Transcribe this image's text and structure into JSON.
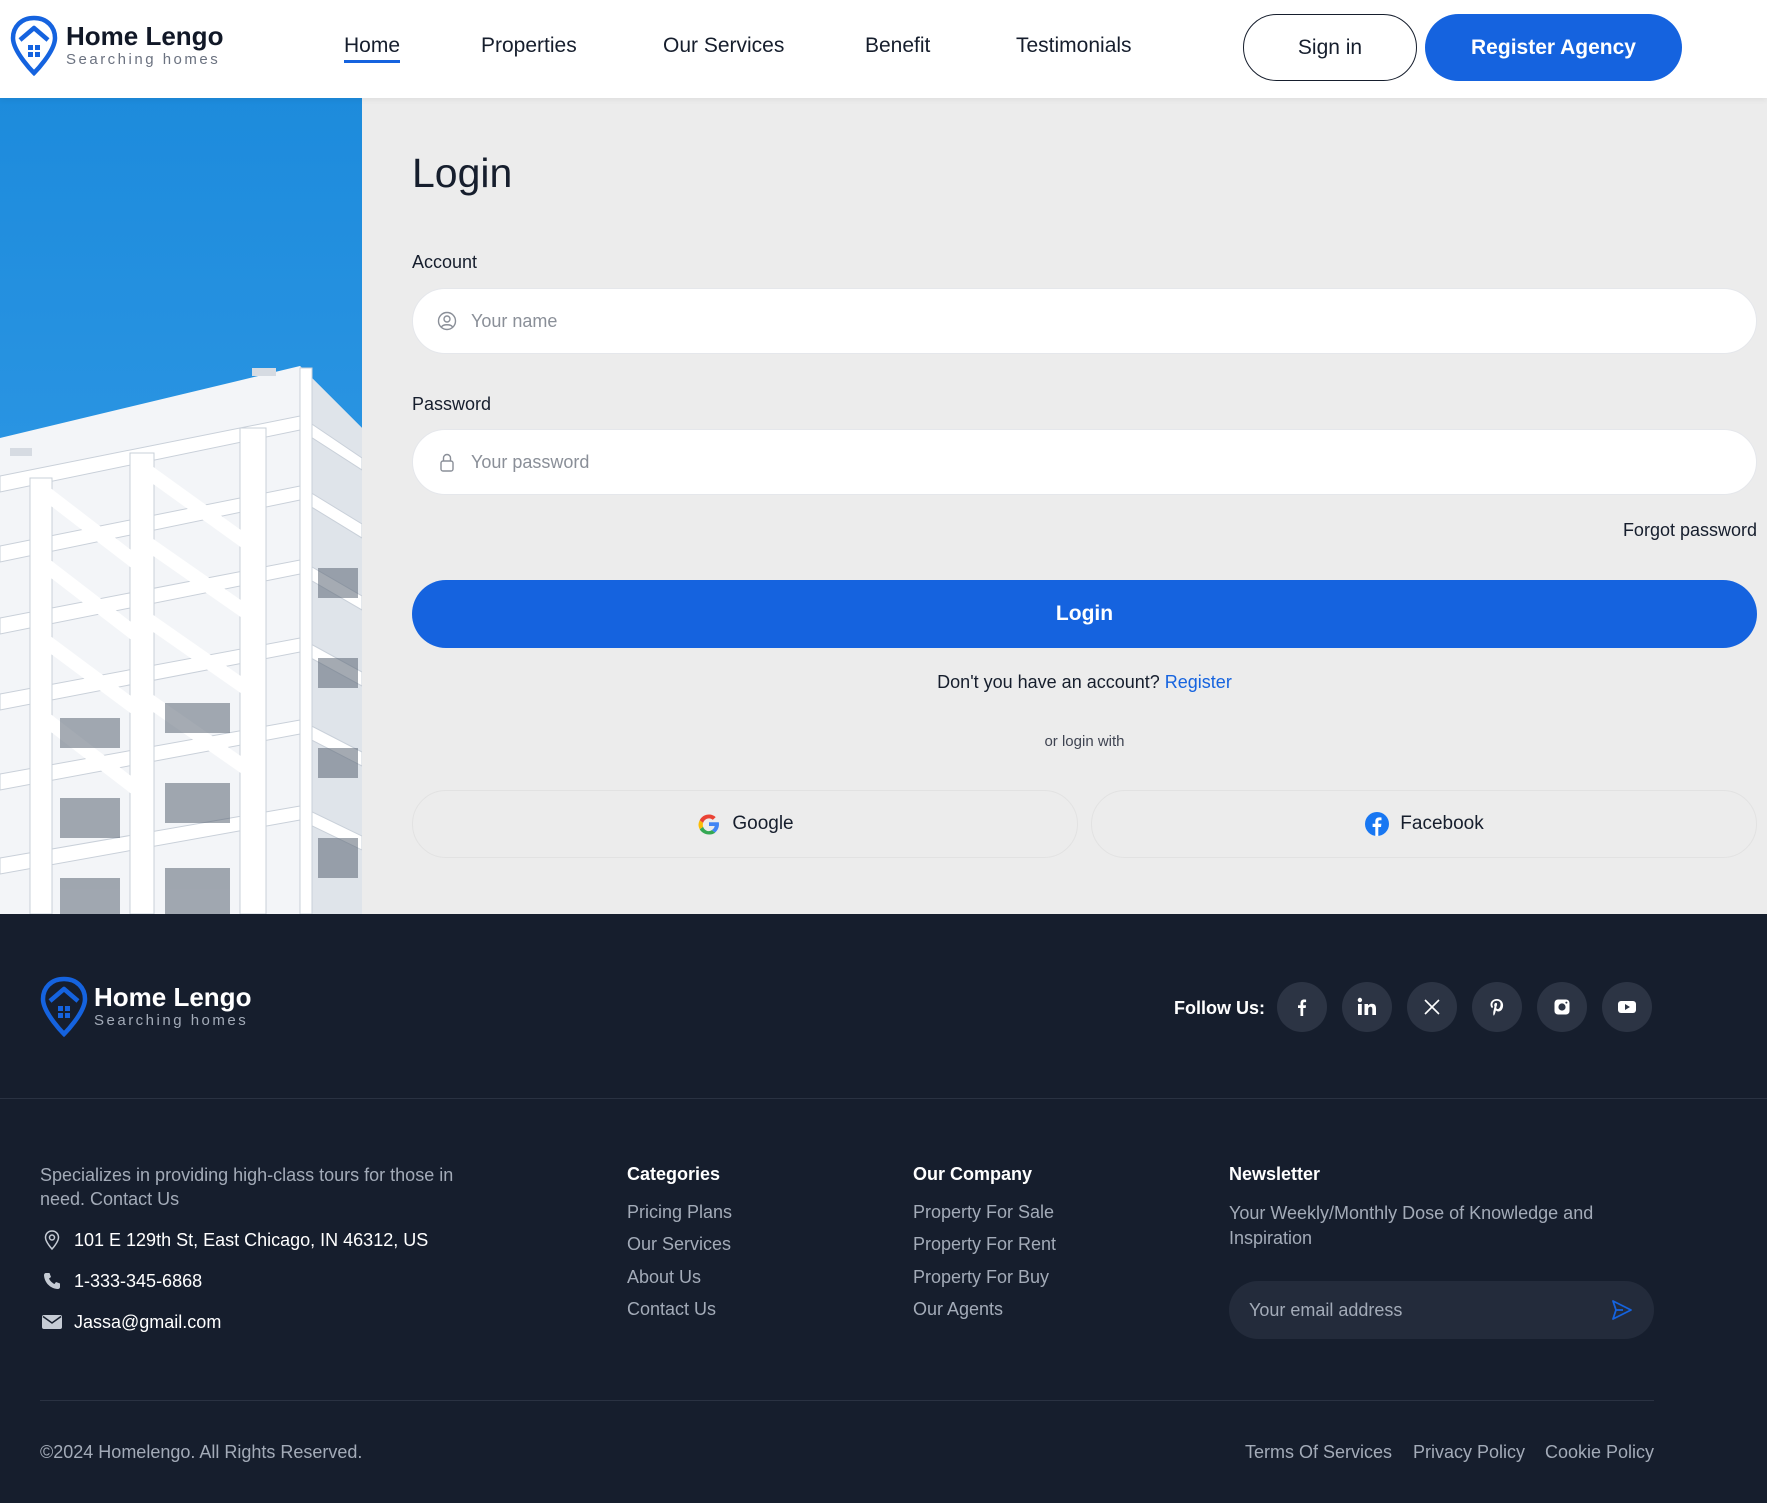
{
  "brand": {
    "name": "Home Lengo",
    "tagline": "Searching homes",
    "accent_color": "#1563df",
    "dark_color": "#161e2d"
  },
  "header": {
    "nav": [
      {
        "label": "Home",
        "active": true
      },
      {
        "label": "Properties"
      },
      {
        "label": "Our Services"
      },
      {
        "label": "Benefit"
      },
      {
        "label": "Testimonials"
      }
    ],
    "signin_label": "Sign in",
    "register_label": "Register Agency"
  },
  "login": {
    "title": "Login",
    "account_label": "Account",
    "account_placeholder": "Your name",
    "password_label": "Password",
    "password_placeholder": "Your password",
    "forgot_label": "Forgot password",
    "login_button": "Login",
    "no_account_text": "Don't you have an account?",
    "register_link": "Register",
    "or_login_with": "or login with",
    "google_label": "Google",
    "facebook_label": "Facebook"
  },
  "footer": {
    "follow_label": "Follow Us:",
    "social_icons": [
      "facebook-icon",
      "linkedin-icon",
      "x-icon",
      "pinterest-icon",
      "instagram-icon",
      "youtube-icon"
    ],
    "about": "Specializes in providing high-class tours for those in need. Contact Us",
    "address": "101 E 129th St, East Chicago, IN 46312, US",
    "phone": "1-333-345-6868",
    "email": "Jassa@gmail.com",
    "categories": {
      "title": "Categories",
      "links": [
        "Pricing Plans",
        "Our Services",
        "About Us",
        "Contact Us"
      ]
    },
    "company": {
      "title": "Our Company",
      "links": [
        "Property For Sale",
        "Property For Rent",
        "Property For Buy",
        "Our Agents"
      ]
    },
    "newsletter": {
      "title": "Newsletter",
      "text": "Your Weekly/Monthly Dose of Knowledge and Inspiration",
      "placeholder": "Your email address"
    },
    "copyright": "©2024 Homelengo. All Rights Reserved.",
    "legal": [
      "Terms Of Services",
      "Privacy Policy",
      "Cookie Policy"
    ]
  }
}
